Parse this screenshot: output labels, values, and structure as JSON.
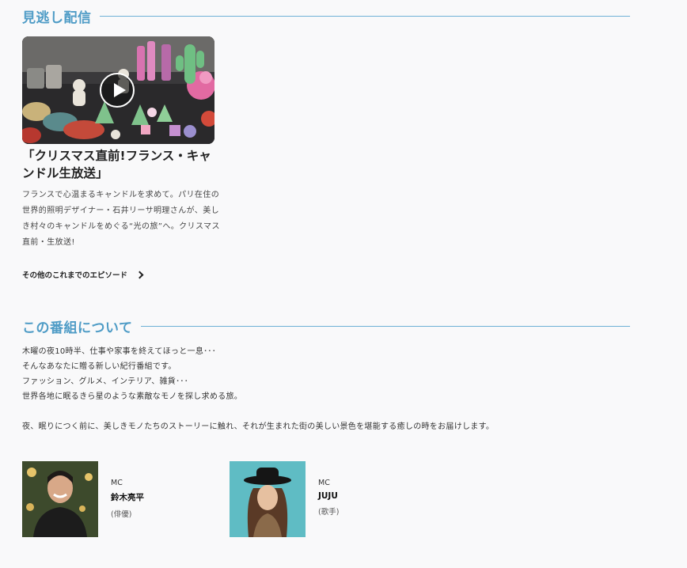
{
  "missed": {
    "heading": "見逃し配信",
    "episode": {
      "title": "「クリスマス直前!フランス・キャンドル生放送」",
      "description": "フランスで心温まるキャンドルを求めて。パリ在住の世界的照明デザイナー・石井リーサ明理さんが、美しき村々のキャンドルをめぐる“光の旅”へ。クリスマス直前・生放送!",
      "thumbnail_icon": "play-icon"
    },
    "other_episodes_label": "その他のこれまでのエピソード"
  },
  "about": {
    "heading": "この番組について",
    "lines": [
      "木曜の夜10時半、仕事や家事を終えてほっと一息･･･",
      "そんなあなたに贈る新しい紀行番組です。",
      "ファッション、グルメ、インテリア、雑貨･･･",
      "世界各地に眠るきら星のような素敵なモノを探し求める旅。"
    ],
    "closing": "夜、眠りにつく前に、美しきモノたちのストーリーに触れ、それが生まれた街の美しい景色を堪能する癒しの時をお届けします。"
  },
  "cast": [
    {
      "role": "MC",
      "name": "鈴木亮平",
      "sub": "(俳優)"
    },
    {
      "role": "MC",
      "name": "JUJU",
      "sub": "(歌手)"
    }
  ],
  "colors": {
    "accent": "#4f9cc6",
    "background": "#f9f9fa"
  }
}
